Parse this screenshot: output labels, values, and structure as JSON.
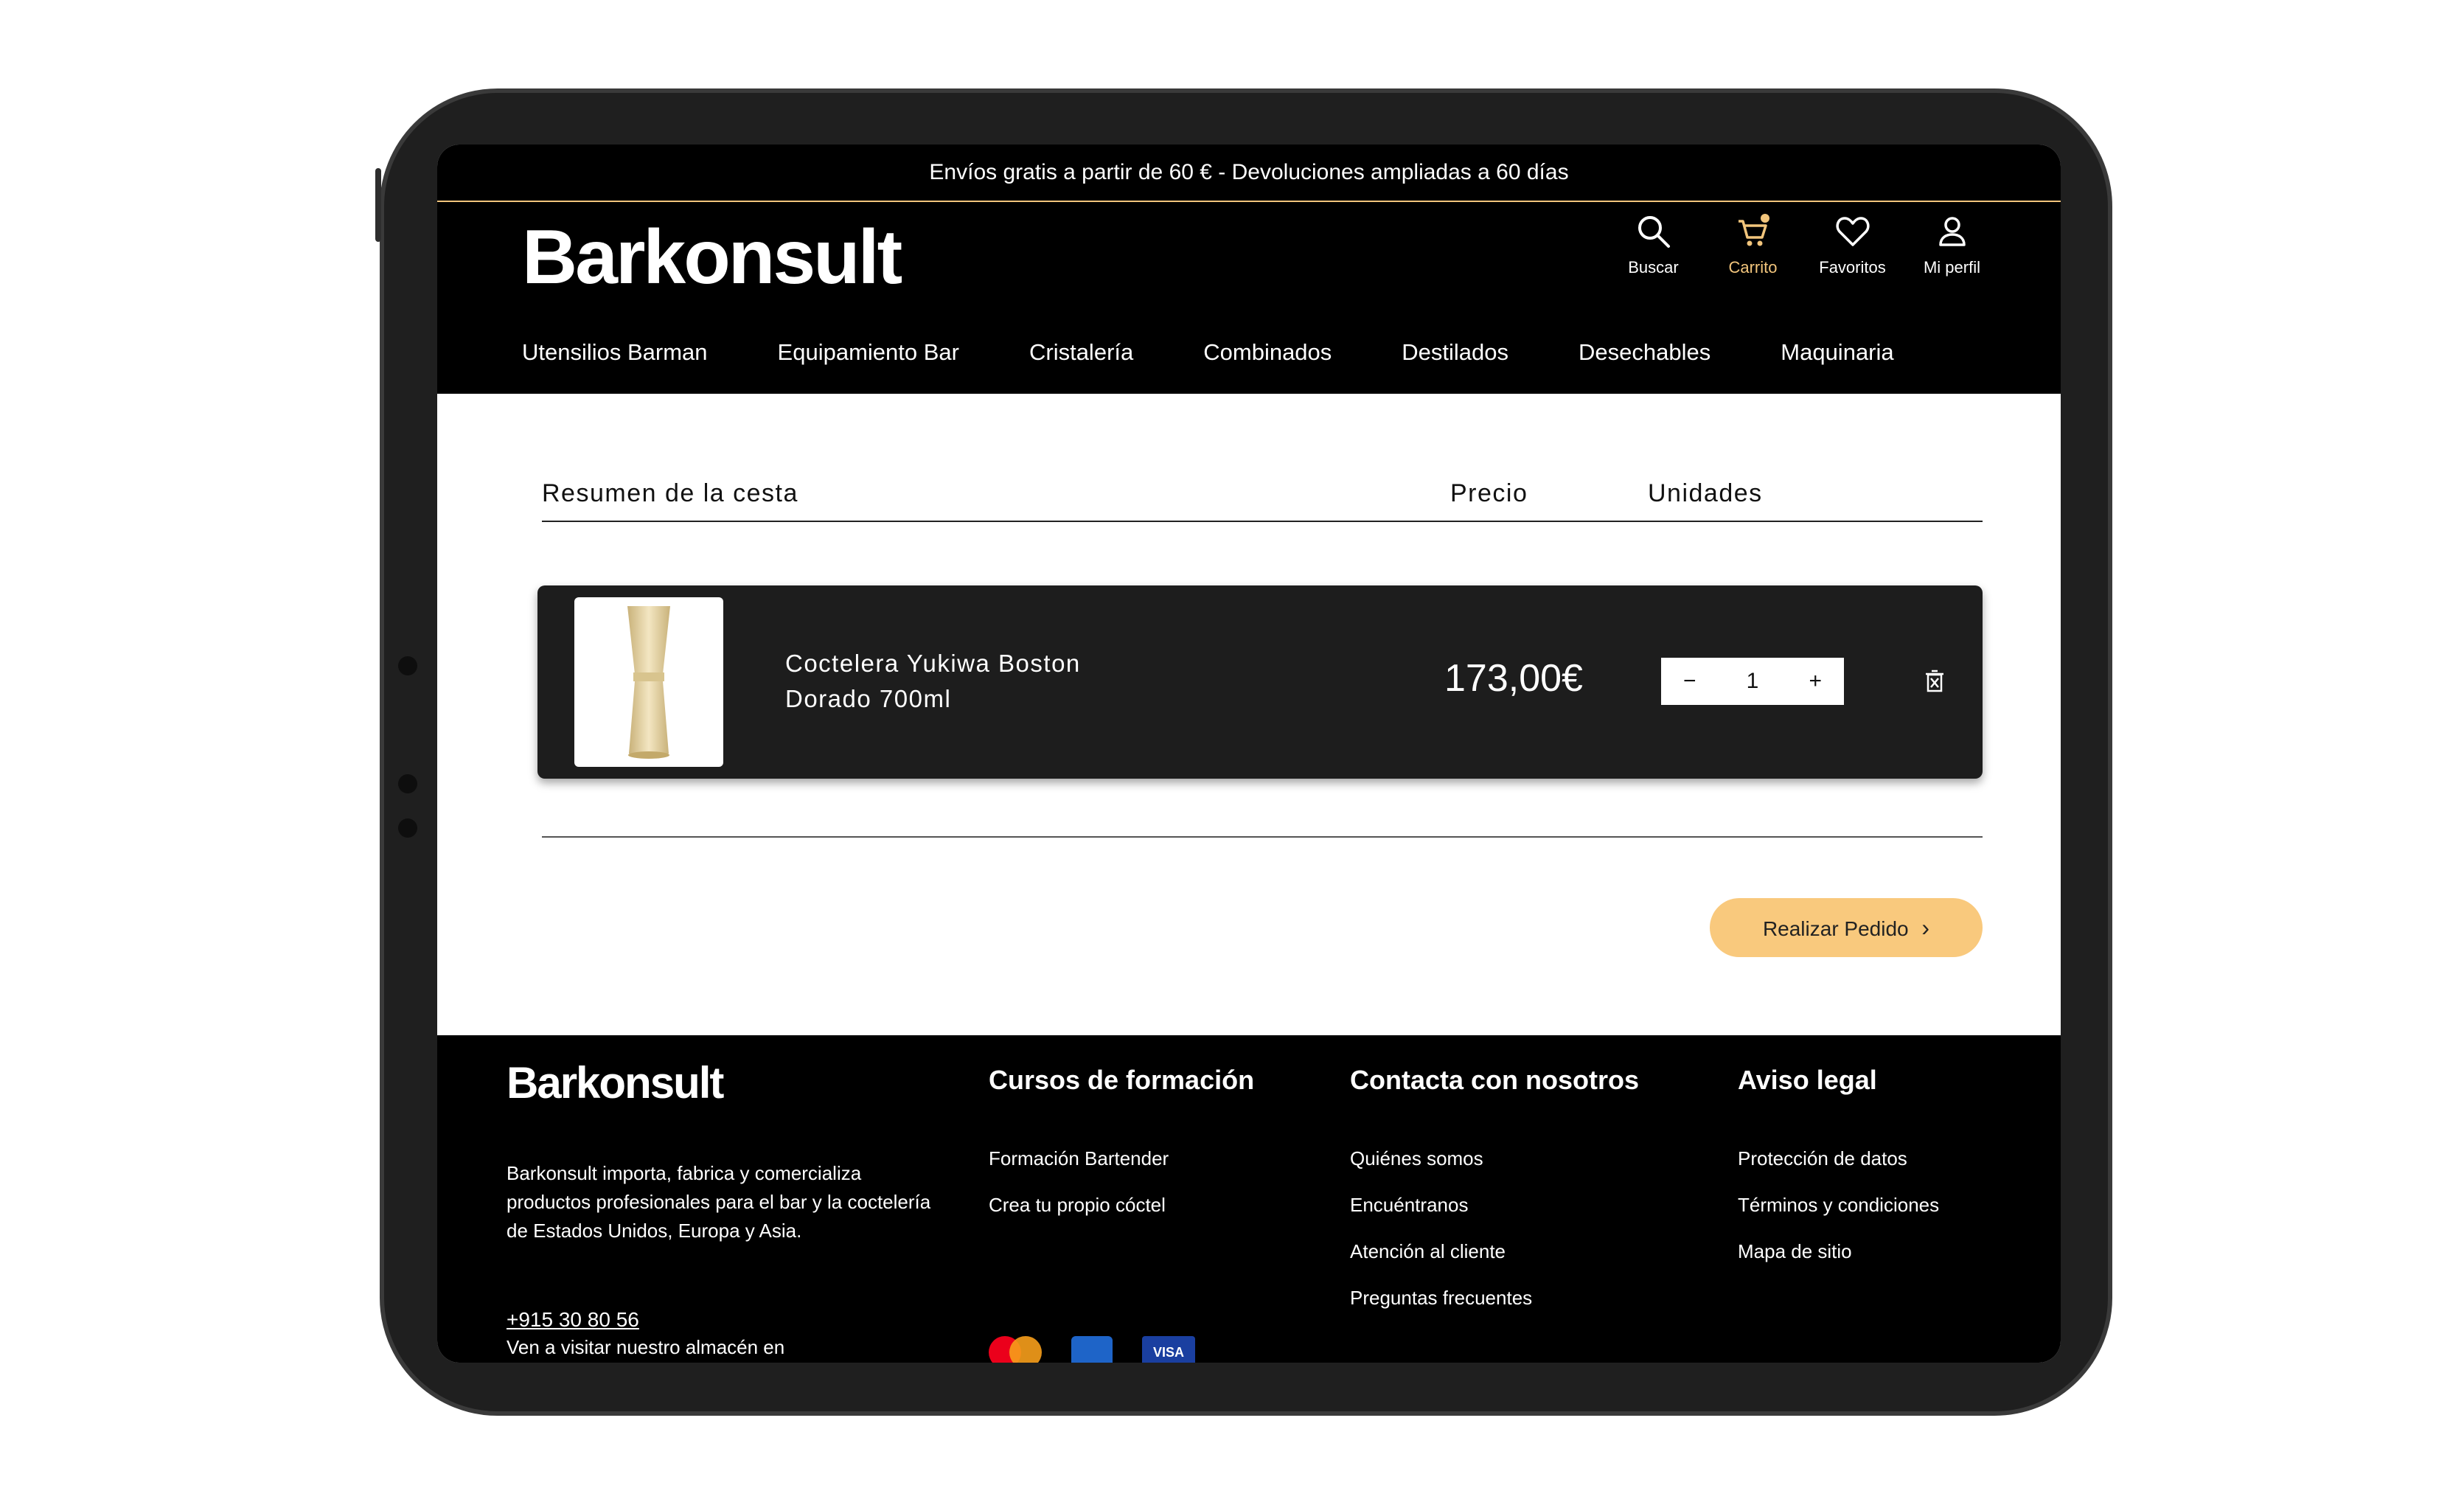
{
  "topbar": {
    "text": "Envíos gratis a partir de 60 € - Devoluciones ampliadas a 60 días"
  },
  "header": {
    "logo": "Barkonsult",
    "icons": [
      {
        "icon": "search-icon",
        "label": "Buscar"
      },
      {
        "icon": "cart-icon",
        "label": "Carrito"
      },
      {
        "icon": "heart-icon",
        "label": "Favoritos"
      },
      {
        "icon": "user-icon",
        "label": "Mi perfil"
      }
    ],
    "accent": "#f2c57c"
  },
  "nav": [
    "Utensilios Barman",
    "Equipamiento Bar",
    "Cristalería",
    "Combinados",
    "Destilados",
    "Desechables",
    "Maquinaria"
  ],
  "cart": {
    "summary_label": "Resumen de la cesta",
    "price_label": "Precio",
    "units_label": "Unidades",
    "item": {
      "name": "Coctelera Yukiwa Boston Dorado 700ml",
      "price": "173,00€",
      "quantity": "1",
      "minus": "−",
      "plus": "+"
    },
    "order_button": "Realizar Pedido"
  },
  "footer": {
    "logo": "Barkonsult",
    "description": "Barkonsult importa, fabrica y comercializa productos profesionales para el bar y la coctelería de Estados Unidos, Europa y Asia.",
    "phone": "+915 30 80 56",
    "visit": "Ven a visitar nuestro almacén en",
    "col1": {
      "title": "Cursos de formación",
      "links": [
        "Formación Bartender",
        "Crea tu propio cóctel"
      ]
    },
    "col2": {
      "title": "Contacta con nosotros",
      "links": [
        "Quiénes somos",
        "Encuéntranos",
        "Atención al cliente",
        "Preguntas frecuentes"
      ]
    },
    "col3": {
      "title": "Aviso legal",
      "links": [
        "Protección de datos",
        "Términos y condiciones",
        "Mapa de sitio"
      ]
    },
    "payment": {
      "visa_label": "VISA"
    }
  }
}
